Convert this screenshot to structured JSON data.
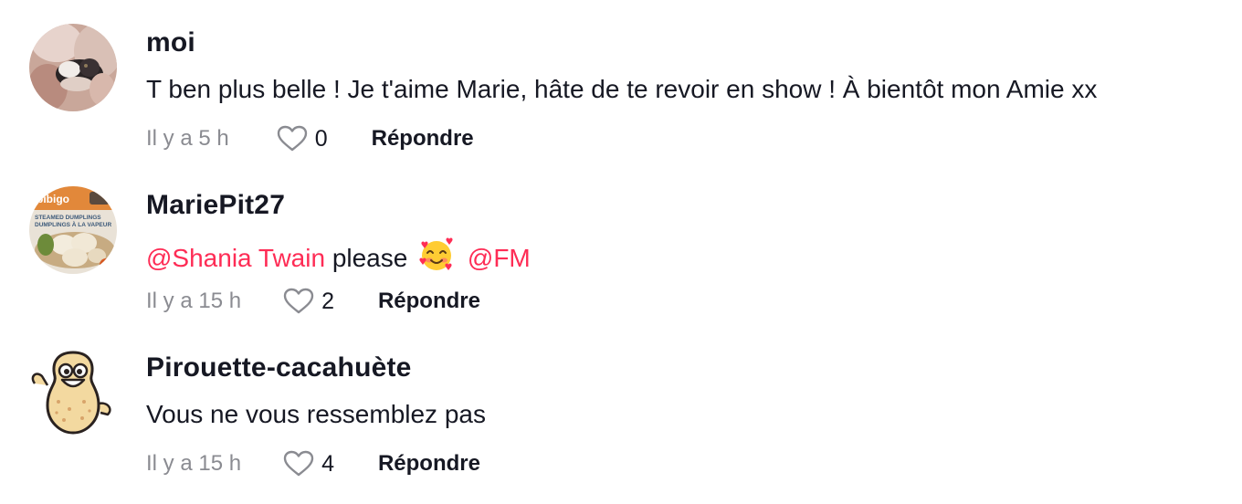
{
  "comments": [
    {
      "username": "moi",
      "text": "T ben plus belle ! Je t'aime Marie, hâte de te revoir en show ! À bientôt mon Amie xx",
      "time": "Il y a 5 h",
      "likes": "0",
      "reply_label": "Répondre"
    },
    {
      "username": "MariePit27",
      "mention1": "@Shania Twain",
      "text": "please",
      "emoji": "smiling-face-with-hearts",
      "mention2": "@FM",
      "time": "Il y a 15 h",
      "likes": "2",
      "reply_label": "Répondre",
      "avatar_label_top": "bibigo",
      "avatar_label_line1": "STEAMED DUMPLINGS",
      "avatar_label_line2": "DUMPLINGS À LA VAPEUR"
    },
    {
      "username": "Pirouette-cacahuète",
      "text": "Vous ne vous ressemblez pas",
      "time": "Il y a 15 h",
      "likes": "4",
      "reply_label": "Répondre"
    }
  ],
  "colors": {
    "mention": "#fe2c55",
    "meta_gray": "#8a8b91",
    "text": "#161823"
  }
}
